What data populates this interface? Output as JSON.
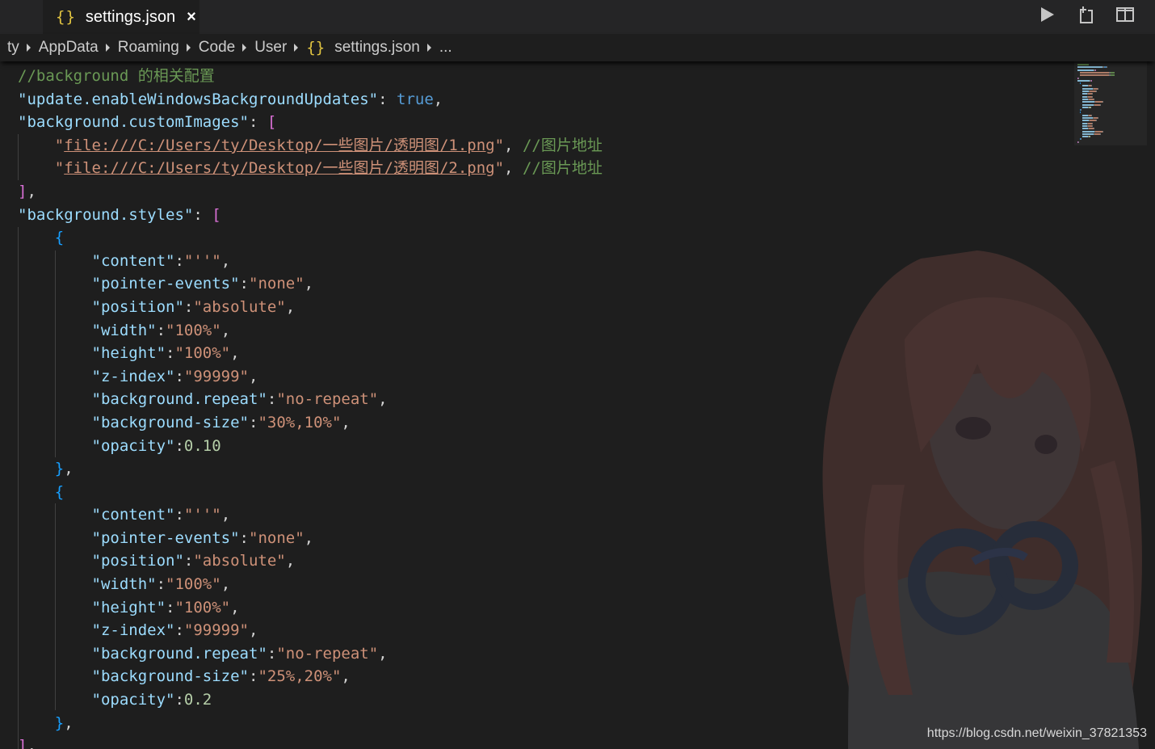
{
  "tab": {
    "icon_text": "{}",
    "title": "settings.json",
    "close_glyph": "×"
  },
  "editor_actions": {
    "run_icon": "play-icon",
    "open_changes_icon": "open-changes-icon",
    "split_icon": "split-editor-icon"
  },
  "breadcrumb": {
    "items": [
      "ty",
      "AppData",
      "Roaming",
      "Code",
      "User",
      "settings.json",
      "..."
    ],
    "file_icon_text": "{}"
  },
  "code_lines": [
    [
      {
        "t": "comment",
        "v": "//background 的相关配置"
      }
    ],
    [
      {
        "t": "key",
        "v": "\"update.enableWindowsBackgroundUpdates\""
      },
      {
        "t": "punc",
        "v": ": "
      },
      {
        "t": "bool",
        "v": "true"
      },
      {
        "t": "punc",
        "v": ","
      }
    ],
    [
      {
        "t": "key",
        "v": "\"background.customImages\""
      },
      {
        "t": "punc",
        "v": ": "
      },
      {
        "t": "brk1",
        "v": "["
      }
    ],
    [
      {
        "t": "punc",
        "v": "    "
      },
      {
        "t": "str",
        "v": "\""
      },
      {
        "t": "link",
        "v": "file:///C:/Users/ty/Desktop/一些图片/透明图/1.png"
      },
      {
        "t": "str",
        "v": "\""
      },
      {
        "t": "punc",
        "v": ", "
      },
      {
        "t": "comment",
        "v": "//图片地址"
      }
    ],
    [
      {
        "t": "punc",
        "v": "    "
      },
      {
        "t": "str",
        "v": "\""
      },
      {
        "t": "link",
        "v": "file:///C:/Users/ty/Desktop/一些图片/透明图/2.png"
      },
      {
        "t": "str",
        "v": "\""
      },
      {
        "t": "punc",
        "v": ", "
      },
      {
        "t": "comment",
        "v": "//图片地址"
      }
    ],
    [
      {
        "t": "brk1",
        "v": "]"
      },
      {
        "t": "punc",
        "v": ","
      }
    ],
    [
      {
        "t": "key",
        "v": "\"background.styles\""
      },
      {
        "t": "punc",
        "v": ": "
      },
      {
        "t": "brk1",
        "v": "["
      }
    ],
    [
      {
        "t": "punc",
        "v": "    "
      },
      {
        "t": "brk2",
        "v": "{"
      }
    ],
    [
      {
        "t": "punc",
        "v": "        "
      },
      {
        "t": "key",
        "v": "\"content\""
      },
      {
        "t": "punc",
        "v": ":"
      },
      {
        "t": "str",
        "v": "\"''\""
      },
      {
        "t": "punc",
        "v": ","
      }
    ],
    [
      {
        "t": "punc",
        "v": "        "
      },
      {
        "t": "key",
        "v": "\"pointer-events\""
      },
      {
        "t": "punc",
        "v": ":"
      },
      {
        "t": "str",
        "v": "\"none\""
      },
      {
        "t": "punc",
        "v": ","
      }
    ],
    [
      {
        "t": "punc",
        "v": "        "
      },
      {
        "t": "key",
        "v": "\"position\""
      },
      {
        "t": "punc",
        "v": ":"
      },
      {
        "t": "str",
        "v": "\"absolute\""
      },
      {
        "t": "punc",
        "v": ","
      }
    ],
    [
      {
        "t": "punc",
        "v": "        "
      },
      {
        "t": "key",
        "v": "\"width\""
      },
      {
        "t": "punc",
        "v": ":"
      },
      {
        "t": "str",
        "v": "\"100%\""
      },
      {
        "t": "punc",
        "v": ","
      }
    ],
    [
      {
        "t": "punc",
        "v": "        "
      },
      {
        "t": "key",
        "v": "\"height\""
      },
      {
        "t": "punc",
        "v": ":"
      },
      {
        "t": "str",
        "v": "\"100%\""
      },
      {
        "t": "punc",
        "v": ","
      }
    ],
    [
      {
        "t": "punc",
        "v": "        "
      },
      {
        "t": "key",
        "v": "\"z-index\""
      },
      {
        "t": "punc",
        "v": ":"
      },
      {
        "t": "str",
        "v": "\"99999\""
      },
      {
        "t": "punc",
        "v": ","
      }
    ],
    [
      {
        "t": "punc",
        "v": "        "
      },
      {
        "t": "key",
        "v": "\"background.repeat\""
      },
      {
        "t": "punc",
        "v": ":"
      },
      {
        "t": "str",
        "v": "\"no-repeat\""
      },
      {
        "t": "punc",
        "v": ","
      }
    ],
    [
      {
        "t": "punc",
        "v": "        "
      },
      {
        "t": "key",
        "v": "\"background-size\""
      },
      {
        "t": "punc",
        "v": ":"
      },
      {
        "t": "str",
        "v": "\"30%,10%\""
      },
      {
        "t": "punc",
        "v": ","
      }
    ],
    [
      {
        "t": "punc",
        "v": "        "
      },
      {
        "t": "key",
        "v": "\"opacity\""
      },
      {
        "t": "punc",
        "v": ":"
      },
      {
        "t": "num",
        "v": "0.10"
      }
    ],
    [
      {
        "t": "punc",
        "v": "    "
      },
      {
        "t": "brk2",
        "v": "}"
      },
      {
        "t": "punc",
        "v": ","
      }
    ],
    [
      {
        "t": "punc",
        "v": "    "
      },
      {
        "t": "brk2",
        "v": "{"
      }
    ],
    [
      {
        "t": "punc",
        "v": "        "
      },
      {
        "t": "key",
        "v": "\"content\""
      },
      {
        "t": "punc",
        "v": ":"
      },
      {
        "t": "str",
        "v": "\"''\""
      },
      {
        "t": "punc",
        "v": ","
      }
    ],
    [
      {
        "t": "punc",
        "v": "        "
      },
      {
        "t": "key",
        "v": "\"pointer-events\""
      },
      {
        "t": "punc",
        "v": ":"
      },
      {
        "t": "str",
        "v": "\"none\""
      },
      {
        "t": "punc",
        "v": ","
      }
    ],
    [
      {
        "t": "punc",
        "v": "        "
      },
      {
        "t": "key",
        "v": "\"position\""
      },
      {
        "t": "punc",
        "v": ":"
      },
      {
        "t": "str",
        "v": "\"absolute\""
      },
      {
        "t": "punc",
        "v": ","
      }
    ],
    [
      {
        "t": "punc",
        "v": "        "
      },
      {
        "t": "key",
        "v": "\"width\""
      },
      {
        "t": "punc",
        "v": ":"
      },
      {
        "t": "str",
        "v": "\"100%\""
      },
      {
        "t": "punc",
        "v": ","
      }
    ],
    [
      {
        "t": "punc",
        "v": "        "
      },
      {
        "t": "key",
        "v": "\"height\""
      },
      {
        "t": "punc",
        "v": ":"
      },
      {
        "t": "str",
        "v": "\"100%\""
      },
      {
        "t": "punc",
        "v": ","
      }
    ],
    [
      {
        "t": "punc",
        "v": "        "
      },
      {
        "t": "key",
        "v": "\"z-index\""
      },
      {
        "t": "punc",
        "v": ":"
      },
      {
        "t": "str",
        "v": "\"99999\""
      },
      {
        "t": "punc",
        "v": ","
      }
    ],
    [
      {
        "t": "punc",
        "v": "        "
      },
      {
        "t": "key",
        "v": "\"background.repeat\""
      },
      {
        "t": "punc",
        "v": ":"
      },
      {
        "t": "str",
        "v": "\"no-repeat\""
      },
      {
        "t": "punc",
        "v": ","
      }
    ],
    [
      {
        "t": "punc",
        "v": "        "
      },
      {
        "t": "key",
        "v": "\"background-size\""
      },
      {
        "t": "punc",
        "v": ":"
      },
      {
        "t": "str",
        "v": "\"25%,20%\""
      },
      {
        "t": "punc",
        "v": ","
      }
    ],
    [
      {
        "t": "punc",
        "v": "        "
      },
      {
        "t": "key",
        "v": "\"opacity\""
      },
      {
        "t": "punc",
        "v": ":"
      },
      {
        "t": "num",
        "v": "0.2"
      }
    ],
    [
      {
        "t": "punc",
        "v": "    "
      },
      {
        "t": "brk2",
        "v": "}"
      },
      {
        "t": "punc",
        "v": ","
      }
    ],
    [
      {
        "t": "brk1",
        "v": "]"
      },
      {
        "t": "punc",
        "v": ","
      }
    ]
  ],
  "watermark": "https://blog.csdn.net/weixin_37821353",
  "colors": {
    "editor_bg": "#1e1e1e",
    "tabbar_bg": "#252526",
    "key": "#9cdcfe",
    "string": "#ce9178",
    "number": "#b5cea8",
    "boolean": "#569cd6",
    "comment": "#6a9955",
    "bracket_level1": "#da70d6",
    "bracket_level2": "#179fff",
    "json_icon": "#e2c541"
  }
}
